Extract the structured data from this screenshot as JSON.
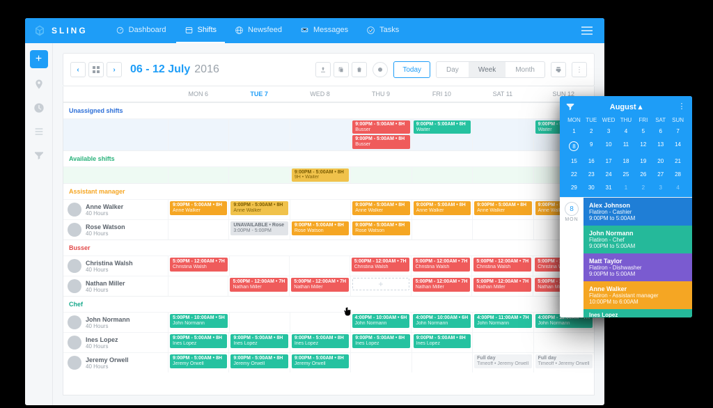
{
  "app": {
    "brand": "SLING",
    "nav": [
      {
        "id": "dashboard",
        "label": "Dashboard"
      },
      {
        "id": "shifts",
        "label": "Shifts",
        "active": true
      },
      {
        "id": "newsfeed",
        "label": "Newsfeed"
      },
      {
        "id": "messages",
        "label": "Messages"
      },
      {
        "id": "tasks",
        "label": "Tasks"
      }
    ],
    "toolbar": {
      "range": "06 - 12 July",
      "year": "2016",
      "today_label": "Today",
      "views": {
        "day": "Day",
        "week": "Week",
        "month": "Month",
        "active": "week"
      }
    },
    "days": [
      "MON 6",
      "TUE 7",
      "WED 8",
      "THU 9",
      "FRI 10",
      "SAT 11",
      "SUN 12"
    ],
    "active_day_index": 1,
    "sections": {
      "unassigned_label": "Unassigned shifts",
      "available_label": "Available shifts",
      "assistant_label": "Assistant manager",
      "busser_label": "Busser",
      "chef_label": "Chef"
    },
    "unassigned_rows": [
      [
        null,
        null,
        null,
        [
          {
            "c": "red",
            "main": "9:00PM - 5:00AM • 8H",
            "sub": "Busser"
          },
          {
            "c": "red",
            "main": "9:00PM - 5:00AM • 8H",
            "sub": "Busser"
          }
        ],
        [
          {
            "c": "teal",
            "main": "9:00PM - 5:00AM • 8H",
            "sub": "Waiter"
          }
        ],
        null,
        [
          {
            "c": "teal",
            "main": "9:00PM - 5:00AM • 8H",
            "sub": "Waiter"
          }
        ]
      ]
    ],
    "available_rows": [
      [
        null,
        null,
        [
          {
            "c": "amber",
            "main": "9:00PM - 5:00AM • 8H",
            "sub": "9H • Waiter"
          }
        ],
        null,
        null,
        null,
        null
      ]
    ],
    "assistants": [
      {
        "name": "Anne Walker",
        "hours": "40 Hours",
        "cells": [
          [
            {
              "c": "orange",
              "main": "9:00PM - 5:00AM • 8H",
              "sub": "Anne Walker"
            }
          ],
          [
            {
              "c": "amber",
              "main": "9:00PM - 5:00AM • 8H",
              "sub": "Anne Walker"
            }
          ],
          null,
          [
            {
              "c": "orange",
              "main": "9:00PM - 5:00AM • 8H",
              "sub": "Anne Walker"
            }
          ],
          [
            {
              "c": "orange",
              "main": "9:00PM - 5:00AM • 8H",
              "sub": "Anne Walker"
            }
          ],
          [
            {
              "c": "orange",
              "main": "9:00PM - 5:00AM • 8H",
              "sub": "Anne Walker"
            }
          ],
          [
            {
              "c": "orange",
              "main": "9:00PM - 5:00AM • 8H",
              "sub": "Anne Walker"
            }
          ]
        ]
      },
      {
        "name": "Rose Watson",
        "hours": "40 Hours",
        "cells": [
          null,
          [
            {
              "c": "gray",
              "main": "UNAVAILABLE • Rose",
              "sub": "3:00PM - 5:00PM"
            }
          ],
          [
            {
              "c": "orange",
              "main": "9:00PM - 5:00AM • 8H",
              "sub": "Rose Watson"
            }
          ],
          [
            {
              "c": "orange",
              "main": "9:00PM - 5:00AM • 8H",
              "sub": "Rose Watson"
            }
          ],
          null,
          null,
          null
        ]
      }
    ],
    "bussers": [
      {
        "name": "Christina Walsh",
        "hours": "40 Hours",
        "cells": [
          [
            {
              "c": "red",
              "main": "5:00PM - 12:00AM • 7H",
              "sub": "Christina Walsh"
            }
          ],
          null,
          null,
          [
            {
              "c": "red",
              "main": "5:00PM - 12:00AM • 7H",
              "sub": "Christina Walsh"
            }
          ],
          [
            {
              "c": "red",
              "main": "5:00PM - 12:00AM • 7H",
              "sub": "Christina Walsh"
            }
          ],
          [
            {
              "c": "red",
              "main": "5:00PM - 12:00AM • 7H",
              "sub": "Christina Walsh"
            }
          ],
          [
            {
              "c": "red",
              "main": "5:00PM - 12:00AM • 7H",
              "sub": "Christina Walsh"
            }
          ]
        ]
      },
      {
        "name": "Nathan Miller",
        "hours": "40 Hours",
        "cells": [
          null,
          [
            {
              "c": "red",
              "main": "5:00PM - 12:00AM • 7H",
              "sub": "Nathan Miller"
            }
          ],
          [
            {
              "c": "red",
              "main": "5:00PM - 12:00AM • 7H",
              "sub": "Nathan Miller"
            }
          ],
          "ADD",
          [
            {
              "c": "red",
              "main": "5:00PM - 12:00AM • 7H",
              "sub": "Nathan Miller"
            }
          ],
          [
            {
              "c": "red",
              "main": "5:00PM - 12:00AM • 7H",
              "sub": "Nathan Miller"
            }
          ],
          [
            {
              "c": "red",
              "main": "5:00PM - 12:00AM • 7H",
              "sub": "Nathan Miller"
            }
          ]
        ]
      }
    ],
    "chefs": [
      {
        "name": "John Normann",
        "hours": "40 Hours",
        "cells": [
          [
            {
              "c": "teal",
              "main": "5:00PM - 10:00AM • 5H",
              "sub": "John Normann"
            }
          ],
          null,
          null,
          [
            {
              "c": "teal",
              "main": "4:00PM - 10:00AM • 6H",
              "sub": "John Normann"
            }
          ],
          [
            {
              "c": "teal",
              "main": "4:00PM - 10:00AM • 6H",
              "sub": "John Normann"
            }
          ],
          [
            {
              "c": "teal",
              "main": "4:00PM - 11:00AM • 7H",
              "sub": "John Normann"
            }
          ],
          [
            {
              "c": "teal",
              "main": "4:00PM - 11:00AM • 7H",
              "sub": "John Normann"
            }
          ]
        ]
      },
      {
        "name": "Ines Lopez",
        "hours": "40 Hours",
        "cells": [
          [
            {
              "c": "teal",
              "main": "9:00PM - 5:00AM • 8H",
              "sub": "Ines Lopez"
            }
          ],
          [
            {
              "c": "teal",
              "main": "9:00PM - 5:00AM • 8H",
              "sub": "Ines Lopez"
            }
          ],
          [
            {
              "c": "teal",
              "main": "9:00PM - 5:00AM • 8H",
              "sub": "Ines Lopez"
            }
          ],
          [
            {
              "c": "teal",
              "main": "9:00PM - 5:00AM • 8H",
              "sub": "Ines Lopez"
            }
          ],
          [
            {
              "c": "teal",
              "main": "9:00PM - 5:00AM • 8H",
              "sub": "Ines Lopez"
            }
          ],
          null,
          null
        ]
      },
      {
        "name": "Jeremy Orwell",
        "hours": "40 Hours",
        "cells": [
          [
            {
              "c": "teal",
              "main": "9:00PM - 5:00AM • 8H",
              "sub": "Jeremy Orwell"
            }
          ],
          [
            {
              "c": "teal",
              "main": "9:00PM - 5:00AM • 8H",
              "sub": "Jeremy Orwell"
            }
          ],
          [
            {
              "c": "teal",
              "main": "9:00PM - 5:00AM • 8H",
              "sub": "Jeremy Orwell"
            }
          ],
          null,
          null,
          [
            {
              "c": "lightgray",
              "main": "Full day",
              "sub": "Timeoff • Jeremy Orwell"
            }
          ],
          [
            {
              "c": "lightgray",
              "main": "Full day",
              "sub": "Timeoff • Jeremy Orwell"
            }
          ]
        ]
      }
    ]
  },
  "mobile": {
    "title": "August ▴",
    "dow": [
      "MON",
      "TUE",
      "WED",
      "THU",
      "FRI",
      "SAT",
      "SUN"
    ],
    "grid": [
      [
        {
          "n": 1
        },
        {
          "n": 2
        },
        {
          "n": 3
        },
        {
          "n": 4
        },
        {
          "n": 5
        },
        {
          "n": 6
        },
        {
          "n": 7
        }
      ],
      [
        {
          "n": 8,
          "sel": true
        },
        {
          "n": 9
        },
        {
          "n": 10
        },
        {
          "n": 11
        },
        {
          "n": 12
        },
        {
          "n": 13
        },
        {
          "n": 14
        }
      ],
      [
        {
          "n": 15
        },
        {
          "n": 16
        },
        {
          "n": 17
        },
        {
          "n": 18
        },
        {
          "n": 19
        },
        {
          "n": 20
        },
        {
          "n": 21
        }
      ],
      [
        {
          "n": 22
        },
        {
          "n": 23
        },
        {
          "n": 24
        },
        {
          "n": 25
        },
        {
          "n": 26
        },
        {
          "n": 27
        },
        {
          "n": 28
        }
      ],
      [
        {
          "n": 29
        },
        {
          "n": 30
        },
        {
          "n": 31
        },
        {
          "n": 1,
          "dim": true
        },
        {
          "n": 2,
          "dim": true
        },
        {
          "n": 3,
          "dim": true
        },
        {
          "n": 4,
          "dim": true
        }
      ]
    ],
    "day": {
      "num": "8",
      "dow": "MON"
    },
    "cards": [
      {
        "c": "blue",
        "t1": "Alex Johnson",
        "t2a": "Flatiron - Cashier",
        "t2b": "9:00PM to 5:00AM"
      },
      {
        "c": "teal",
        "t1": "John Normann",
        "t2a": "Flatiron - Chef",
        "t2b": "9:00PM to 5:00AM"
      },
      {
        "c": "purple",
        "t1": "Matt Taylor",
        "t2a": "Flatiron - Dishwasher",
        "t2b": "9:00PM to 5:00AM"
      },
      {
        "c": "orange",
        "t1": "Anne Walker",
        "t2a": "Flatiron - Assistant manager",
        "t2b": "10:00PM to 6:00AM"
      }
    ],
    "card_cut": {
      "t1": "Ines Lopez"
    }
  }
}
